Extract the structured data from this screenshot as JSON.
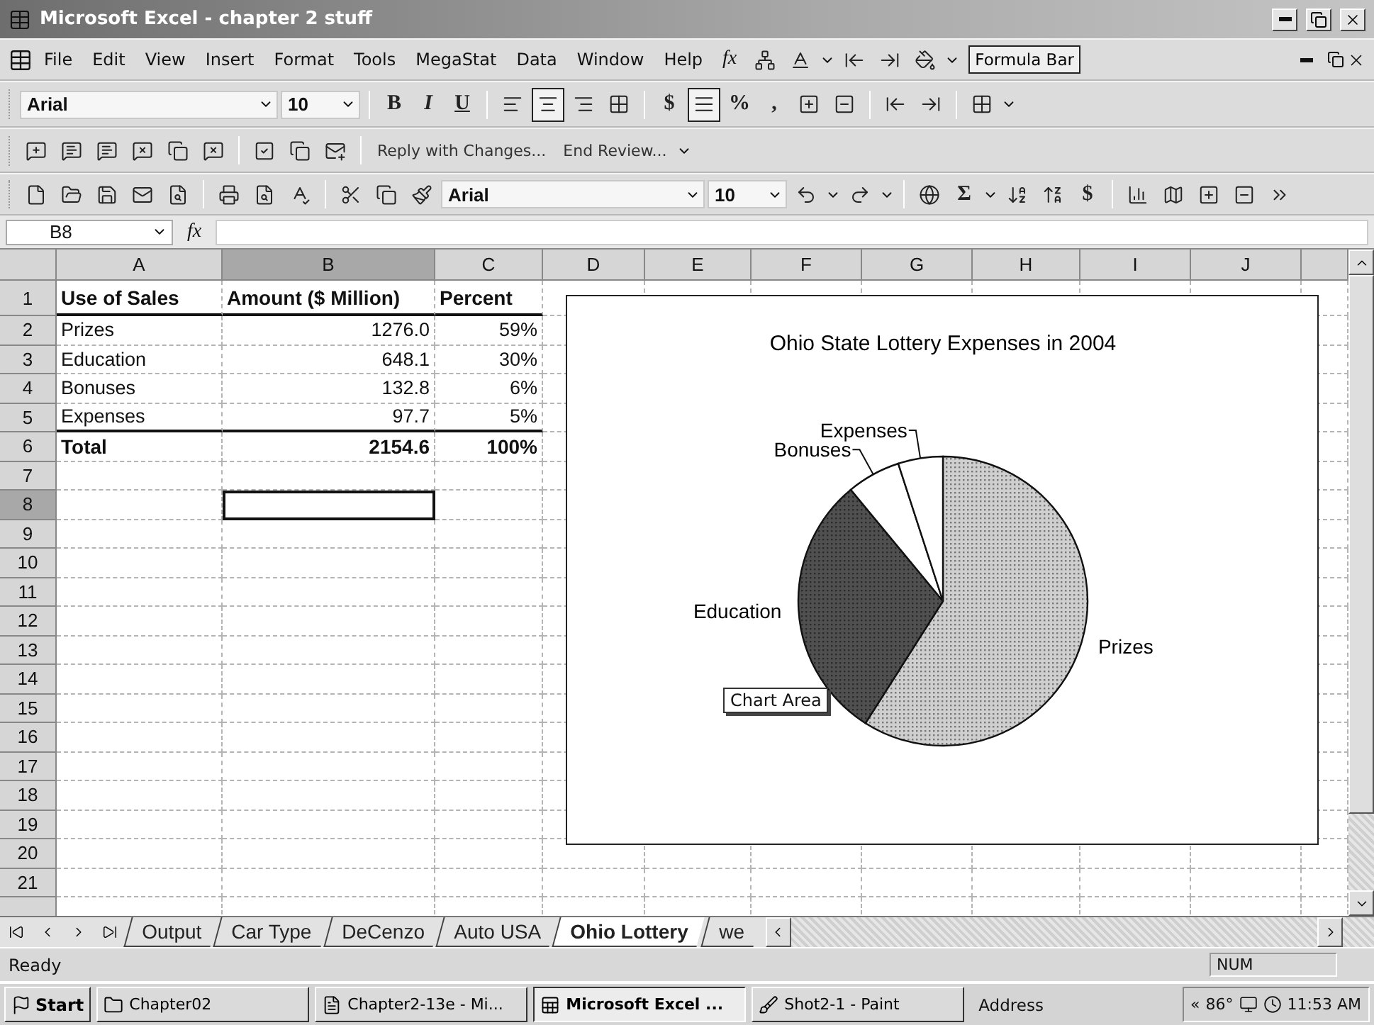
{
  "window": {
    "title": "Microsoft Excel - chapter 2 stuff"
  },
  "menu_bar": {
    "items": [
      {
        "label": "File"
      },
      {
        "label": "Edit"
      },
      {
        "label": "View"
      },
      {
        "label": "Insert"
      },
      {
        "label": "Format"
      },
      {
        "label": "Tools"
      },
      {
        "label": "MegaStat"
      },
      {
        "label": "Data"
      },
      {
        "label": "Window"
      },
      {
        "label": "Help"
      }
    ],
    "function_label": "fx",
    "formula_bar_button": "Formula Bar"
  },
  "formatting_toolbar": {
    "font": "Arial",
    "size": "10",
    "bold": "B",
    "italic": "I",
    "underline": "U",
    "align_buttons": [
      {
        "selected": false
      },
      {
        "selected": true
      },
      {
        "selected": false
      }
    ],
    "currency": "$",
    "distributed_pressed": true,
    "percent": "%",
    "comma": ","
  },
  "reviewing_toolbar": {
    "reply": "Reply with Changes...",
    "end_review": "End Review..."
  },
  "standard_toolbar": {
    "font": "Arial",
    "size": "10",
    "sum": "Σ",
    "currency": "$"
  },
  "formula_bar": {
    "name_box": "B8",
    "function_label": "fx"
  },
  "sheet": {
    "columns": [
      {
        "label": "A",
        "selected": false
      },
      {
        "label": "B",
        "selected": true
      },
      {
        "label": "C",
        "selected": false
      },
      {
        "label": "D",
        "selected": false
      },
      {
        "label": "E",
        "selected": false
      },
      {
        "label": "F",
        "selected": false
      },
      {
        "label": "G",
        "selected": false
      },
      {
        "label": "H",
        "selected": false
      },
      {
        "label": "I",
        "selected": false
      },
      {
        "label": "J",
        "selected": false
      }
    ],
    "rows": [
      {
        "header": "1",
        "selected": false,
        "bold": true,
        "rule_below": true,
        "cells": [
          {
            "text": "Use of Sales",
            "kind": "text",
            "selected": false
          },
          {
            "text": "Amount ($ Million)",
            "kind": "text",
            "selected": false
          },
          {
            "text": "Percent",
            "kind": "text",
            "selected": false
          }
        ]
      },
      {
        "header": "2",
        "selected": false,
        "bold": false,
        "rule_below": false,
        "cells": [
          {
            "text": "Prizes",
            "kind": "text",
            "selected": false
          },
          {
            "text": "1276.0",
            "kind": "number",
            "selected": false
          },
          {
            "text": "59%",
            "kind": "number",
            "selected": false
          }
        ]
      },
      {
        "header": "3",
        "selected": false,
        "bold": false,
        "rule_below": false,
        "cells": [
          {
            "text": "Education",
            "kind": "text",
            "selected": false
          },
          {
            "text": "648.1",
            "kind": "number",
            "selected": false
          },
          {
            "text": "30%",
            "kind": "number",
            "selected": false
          }
        ]
      },
      {
        "header": "4",
        "selected": false,
        "bold": false,
        "rule_below": false,
        "cells": [
          {
            "text": "Bonuses",
            "kind": "text",
            "selected": false
          },
          {
            "text": "132.8",
            "kind": "number",
            "selected": false
          },
          {
            "text": "6%",
            "kind": "number",
            "selected": false
          }
        ]
      },
      {
        "header": "5",
        "selected": false,
        "bold": false,
        "rule_below": true,
        "cells": [
          {
            "text": "Expenses",
            "kind": "text",
            "selected": false
          },
          {
            "text": "97.7",
            "kind": "number",
            "selected": false
          },
          {
            "text": "5%",
            "kind": "number",
            "selected": false
          }
        ]
      },
      {
        "header": "6",
        "selected": false,
        "bold": true,
        "rule_below": false,
        "cells": [
          {
            "text": "Total",
            "kind": "text",
            "selected": false
          },
          {
            "text": "2154.6",
            "kind": "number",
            "selected": false
          },
          {
            "text": "100%",
            "kind": "number",
            "selected": false
          }
        ]
      },
      {
        "header": "7",
        "selected": false
      },
      {
        "header": "8",
        "selected": true,
        "cells": [
          {
            "selected": false
          },
          {
            "selected": true
          },
          {
            "selected": false
          }
        ]
      },
      {
        "header": "9",
        "selected": false
      },
      {
        "header": "10",
        "selected": false
      },
      {
        "header": "11",
        "selected": false
      },
      {
        "header": "12",
        "selected": false
      },
      {
        "header": "13",
        "selected": false
      },
      {
        "header": "14",
        "selected": false
      },
      {
        "header": "15",
        "selected": false
      },
      {
        "header": "16",
        "selected": false
      },
      {
        "header": "17",
        "selected": false
      },
      {
        "header": "18",
        "selected": false
      },
      {
        "header": "19",
        "selected": false
      },
      {
        "header": "20",
        "selected": false
      },
      {
        "header": "21",
        "selected": false
      }
    ]
  },
  "chart": {
    "tooltip": "Chart Area",
    "chart_data": {
      "type": "pie",
      "title": "Ohio State Lottery Expenses in 2004",
      "categories": [
        "Prizes",
        "Education",
        "Bonuses",
        "Expenses"
      ],
      "values": [
        59,
        30,
        6,
        5
      ]
    }
  },
  "sheet_tabs": [
    {
      "label": "Output",
      "selected": false
    },
    {
      "label": "Car Type",
      "selected": false
    },
    {
      "label": "DeCenzo",
      "selected": false
    },
    {
      "label": "Auto USA",
      "selected": false
    },
    {
      "label": "Ohio Lottery",
      "selected": true
    },
    {
      "label": "we",
      "selected": false
    }
  ],
  "status_bar": {
    "status": "Ready",
    "num_lock": "NUM"
  },
  "taskbar": {
    "start": "Start",
    "buttons": [
      {
        "label": "Chapter02",
        "kind": "folder",
        "selected": false
      },
      {
        "label": "Chapter2-13e - Mi...",
        "kind": "document",
        "selected": false
      },
      {
        "label": "Microsoft Excel ...",
        "kind": "spreadsheet",
        "selected": true
      },
      {
        "label": "Shot2-1 - Paint",
        "kind": "paint",
        "selected": false
      }
    ],
    "address": "Address",
    "tray_arrow": "«",
    "temperature": "86°",
    "clock": "11:53 AM"
  }
}
